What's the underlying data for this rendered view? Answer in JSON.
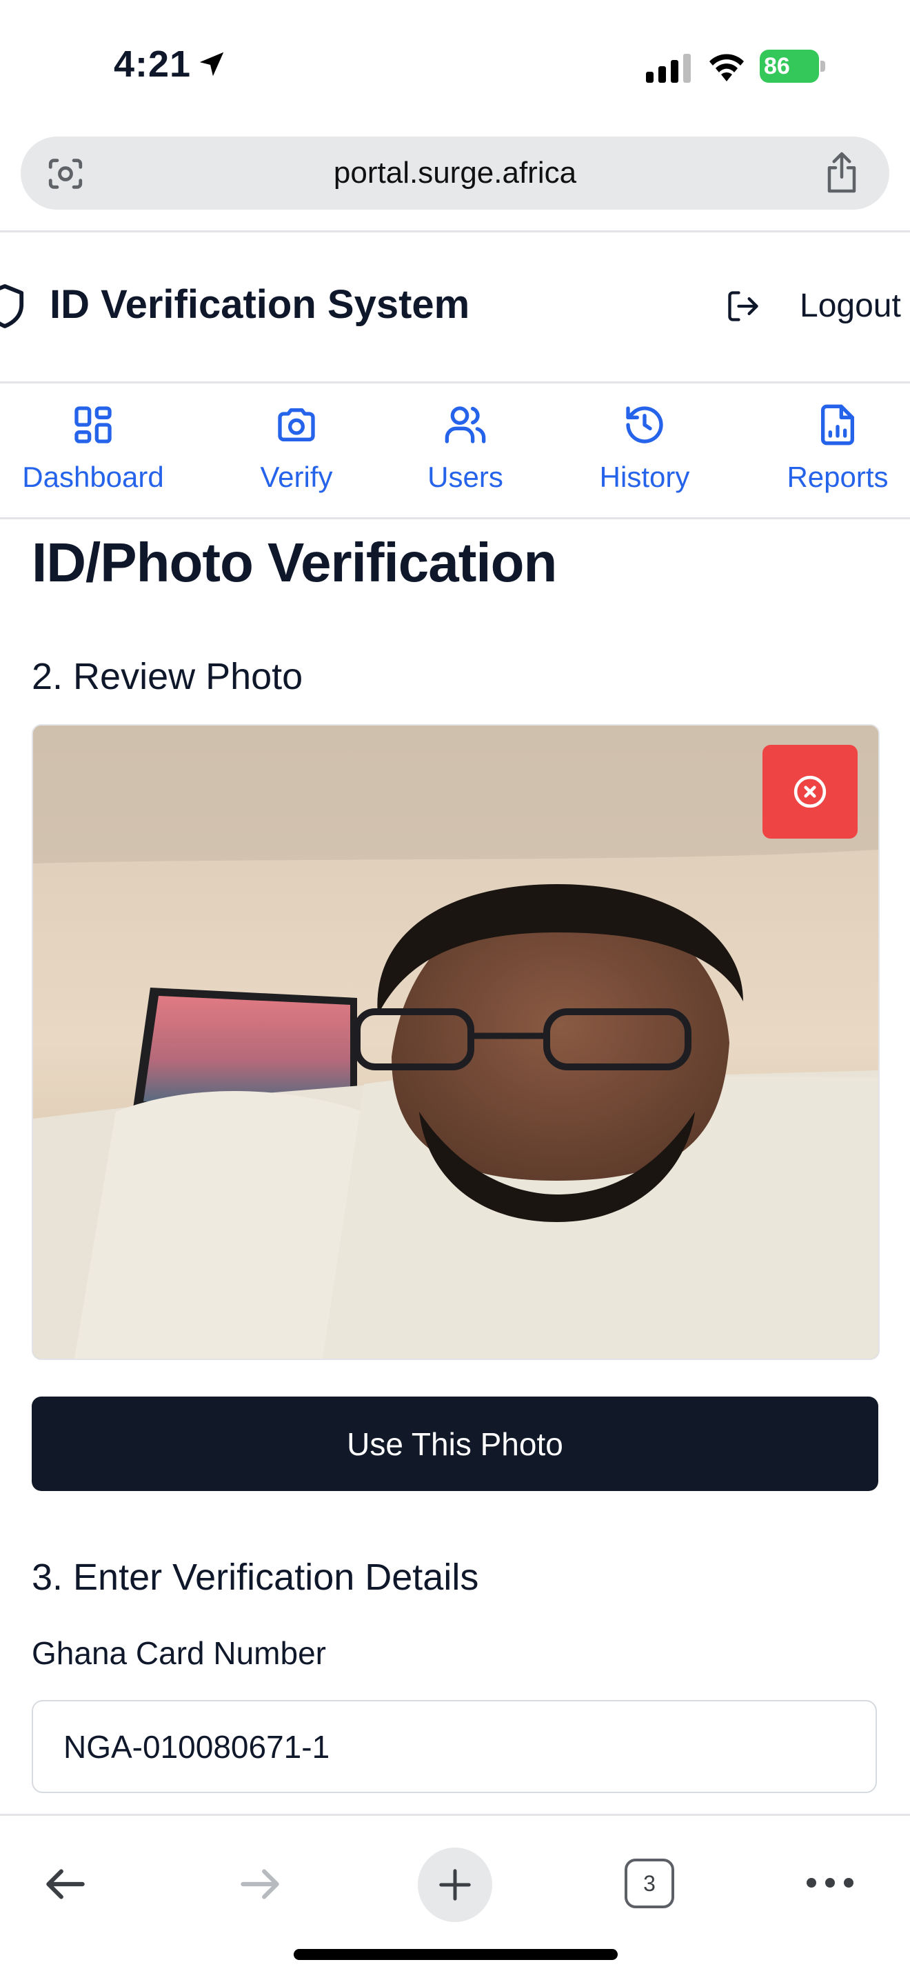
{
  "status_bar": {
    "time": "4:21",
    "battery": "86"
  },
  "browser": {
    "url": "portal.surge.africa",
    "tab_count": "3"
  },
  "header": {
    "title": "ID Verification System",
    "logout_label": "Logout"
  },
  "nav": {
    "items": [
      {
        "label": "Dashboard",
        "icon": "dashboard-icon"
      },
      {
        "label": "Verify",
        "icon": "camera-icon"
      },
      {
        "label": "Users",
        "icon": "users-icon"
      },
      {
        "label": "History",
        "icon": "history-icon"
      },
      {
        "label": "Reports",
        "icon": "reports-icon"
      }
    ],
    "color": "#2563eb"
  },
  "page": {
    "title": "ID/Photo Verification",
    "review_heading": "2. Review Photo",
    "use_photo_label": "Use This Photo",
    "details_heading": "3. Enter Verification Details",
    "card_label": "Ghana Card Number",
    "card_value": "NGA-010080671-1"
  },
  "colors": {
    "accent": "#2563eb",
    "danger": "#ef4444",
    "primary_button": "#111827",
    "battery": "#34c759"
  }
}
